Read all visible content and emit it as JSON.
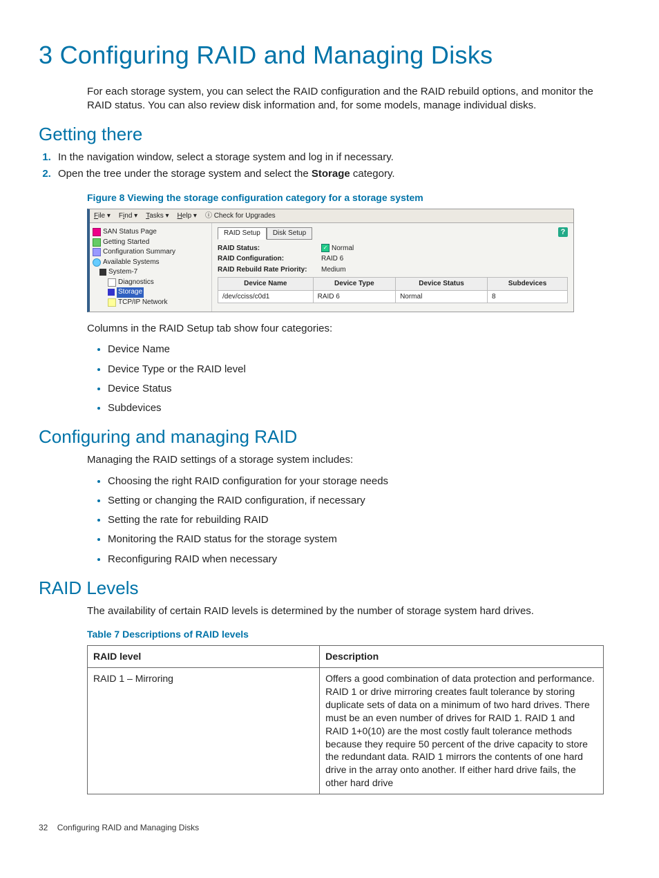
{
  "chapter_title": "3 Configuring RAID and Managing Disks",
  "intro": "For each storage system, you can select the RAID configuration and the RAID rebuild options, and monitor the RAID status. You can also review disk information and, for some models, manage individual disks.",
  "s1": {
    "title": "Getting there",
    "step1": "In the navigation window, select a storage system and log in if necessary.",
    "step2_a": "Open the tree under the storage system and select the ",
    "step2_b": "Storage",
    "step2_c": " category."
  },
  "figure8_caption": "Figure 8 Viewing the storage configuration category for a storage system",
  "shot": {
    "menu": {
      "file": "File ▾",
      "find": "Find ▾",
      "tasks": "Tasks ▾",
      "help": "Help ▾",
      "upg": "ⓘ Check for Upgrades"
    },
    "tree": {
      "san": "SAN Status Page",
      "gs": "Getting Started",
      "cs": "Configuration Summary",
      "as": "Available Systems",
      "sys": "System-7",
      "diag": "Diagnostics",
      "storage": "Storage",
      "net": "TCP/IP Network"
    },
    "tabs": {
      "raid": "RAID Setup",
      "disk": "Disk Setup"
    },
    "kv": {
      "status_k": "RAID Status:",
      "status_v": "Normal",
      "conf_k": "RAID Configuration:",
      "conf_v": "RAID 6",
      "rebuild_k": "RAID Rebuild Rate Priority:",
      "rebuild_v": "Medium"
    },
    "grid": {
      "h1": "Device Name",
      "h2": "Device Type",
      "h3": "Device Status",
      "h4": "Subdevices",
      "r1c1": "/dev/cciss/c0d1",
      "r1c2": "RAID 6",
      "r1c3": "Normal",
      "r1c4": "8"
    }
  },
  "after_fig": "Columns in the RAID Setup tab show four categories:",
  "cols": {
    "a": "Device Name",
    "b": "Device Type or the RAID level",
    "c": "Device Status",
    "d": "Subdevices"
  },
  "s2": {
    "title": "Configuring and managing RAID",
    "lead": "Managing the RAID settings of a storage system includes:",
    "b1": "Choosing the right RAID configuration for your storage needs",
    "b2": "Setting or changing the RAID configuration, if necessary",
    "b3": "Setting the rate for rebuilding RAID",
    "b4": "Monitoring the RAID status for the storage system",
    "b5": "Reconfiguring RAID when necessary"
  },
  "s3": {
    "title": "RAID Levels",
    "lead": "The availability of certain RAID levels is determined by the number of storage system hard drives."
  },
  "table7_caption": "Table 7 Descriptions of RAID levels",
  "table7": {
    "h1": "RAID level",
    "h2": "Description",
    "r1c1": "RAID 1 – Mirroring",
    "r1c2": "Offers a good combination of data protection and performance. RAID 1 or drive mirroring creates fault tolerance by storing duplicate sets of data on a minimum of two hard drives. There must be an even number of drives for RAID 1. RAID 1 and RAID 1+0(10) are the most costly fault tolerance methods because they require 50 percent of the drive capacity to store the redundant data. RAID 1 mirrors the contents of one hard drive in the array onto another. If either hard drive fails, the other hard drive"
  },
  "footer": {
    "page": "32",
    "title": "Configuring RAID and Managing Disks"
  }
}
